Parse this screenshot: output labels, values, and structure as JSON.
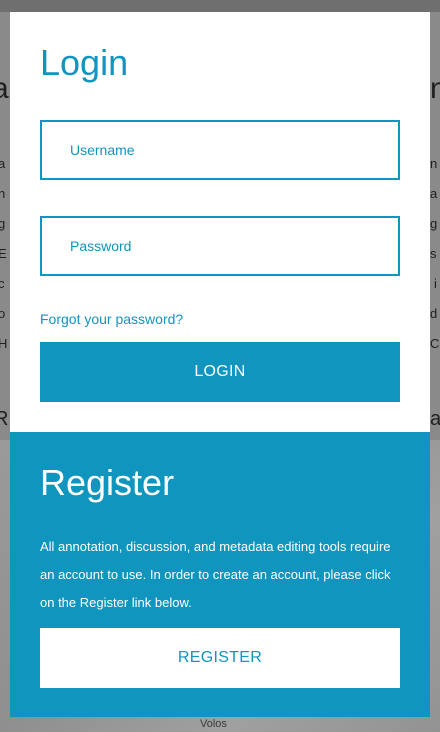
{
  "background": {
    "map_label": "Volos"
  },
  "login": {
    "title": "Login",
    "username_placeholder": "Username",
    "password_placeholder": "Password",
    "forgot_link": "Forgot your password?",
    "button_label": "LOGIN"
  },
  "register": {
    "title": "Register",
    "description": "All annotation, discussion, and metadata editing tools require an account to use. In order to create an account, please click on the Register link below.",
    "button_label": "REGISTER"
  },
  "colors": {
    "accent": "#0f95be",
    "panel_bg": "#ffffff",
    "overlay": "#8a8a8a"
  }
}
